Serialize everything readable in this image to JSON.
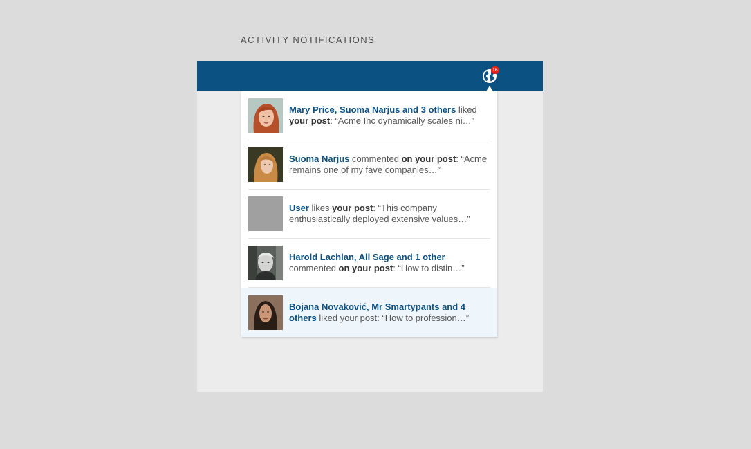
{
  "page": {
    "title": "ACTIVITY NOTIFICATIONS"
  },
  "topbar": {
    "globe_icon": "globe-icon",
    "badge_count": "16"
  },
  "colors": {
    "topbar": "#0b5182",
    "link": "#0b5182",
    "badge": "#e2231a",
    "highlight": "#eef6fb"
  },
  "notifications": [
    {
      "actor": "Mary Price, Suoma Narjus and 3 others",
      "verb": " liked ",
      "target": "your post",
      "tail": ": “Acme Inc dynamically scales ni…”"
    },
    {
      "actor": "Suoma Narjus",
      "verb": " commented ",
      "target": "on your post",
      "tail": ": “Acme remains one of my fave companies…”"
    },
    {
      "actor": "User",
      "verb": " likes ",
      "target": "your post",
      "tail": ": “This company enthusiastically deployed extensive values…”"
    },
    {
      "actor": "Harold Lachlan, Ali Sage and 1 other",
      "verb": " commented ",
      "target": "on your post",
      "tail": ": “How to distin…”"
    },
    {
      "actor": "Bojana Novaković, Mr Smartypants and 4 others",
      "verb": " liked your post: “How to profession…”",
      "target": "",
      "tail": ""
    }
  ]
}
